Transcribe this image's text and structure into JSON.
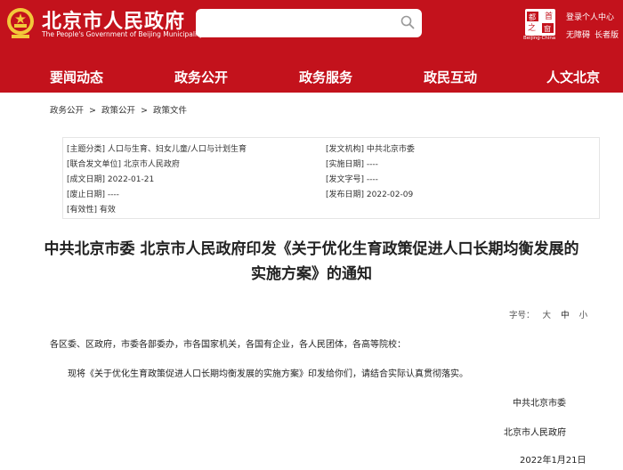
{
  "header": {
    "site_title": "北京市人民政府",
    "site_subtitle": "The People's Government of Beijing Municipality",
    "logo2_line1": "首",
    "logo2_line2": "都",
    "logo2_line3": "之",
    "logo2_line4": "窗",
    "logo2_sub": "Beijing·China",
    "personal_center": "登录个人中心",
    "accessibility": "无障碍",
    "elderly": "长者版",
    "search_placeholder": ""
  },
  "nav": {
    "items": [
      "要闻动态",
      "政务公开",
      "政务服务",
      "政民互动",
      "人文北京"
    ]
  },
  "breadcrumb": {
    "items": [
      "政务公开",
      "政策公开",
      "政策文件"
    ],
    "separator": ">"
  },
  "meta": {
    "topic_label": "[主题分类]",
    "topic_value": "人口与生育、妇女儿童/人口与计划生育",
    "issuer_label": "[发文机构]",
    "issuer_value": "中共北京市委",
    "co_issuer_label": "[联合发文单位]",
    "co_issuer_value": "北京市人民政府",
    "effective_label": "[实施日期]",
    "effective_value": "----",
    "written_label": "[成文日期]",
    "written_value": "2022-01-21",
    "doc_no_label": "[发文字号]",
    "doc_no_value": "----",
    "repeal_label": "[废止日期]",
    "repeal_value": "----",
    "published_label": "[发布日期]",
    "published_value": "2022-02-09",
    "validity_label": "[有效性]",
    "validity_value": "有效"
  },
  "article": {
    "title_line1": "中共北京市委 北京市人民政府印发《关于优化生育政策促进人口长期均衡发展的",
    "title_line2": "实施方案》的通知",
    "font_size_label": "字号：",
    "font_large": "大",
    "font_medium": "中",
    "font_small": "小",
    "recipients": "各区委、区政府，市委各部委办，市各国家机关，各国有企业，各人民团体，各高等院校：",
    "paragraph": "现将《关于优化生育政策促进人口长期均衡发展的实施方案》印发给你们，请结合实际认真贯彻落实。",
    "signature1": "中共北京市委",
    "signature2": "北京市人民政府",
    "date": "2022年1月21日"
  },
  "colors": {
    "header_bg": "#c3121c",
    "emblem_gold": "#f2c83a"
  }
}
